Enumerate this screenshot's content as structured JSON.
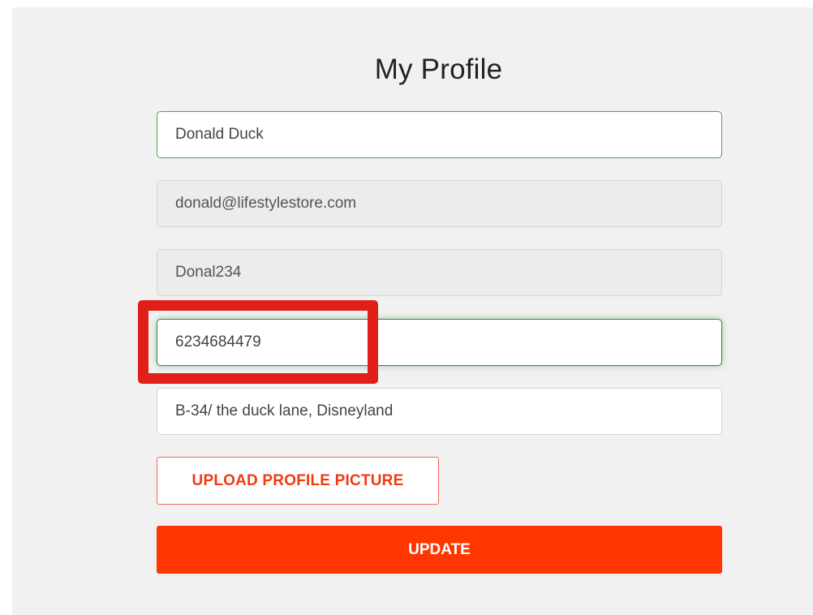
{
  "profile": {
    "title": "My Profile",
    "fields": {
      "name": "Donald Duck",
      "email": "donald@lifestylestore.com",
      "username": "Donal234",
      "phone": "6234684479",
      "address": "B-34/ the duck lane, Disneyland"
    },
    "upload_label": "UPLOAD PROFILE PICTURE",
    "update_label": "UPDATE"
  },
  "colors": {
    "accent": "#ff3600",
    "highlight": "#e02018",
    "focus_border": "#3f7f3f"
  }
}
